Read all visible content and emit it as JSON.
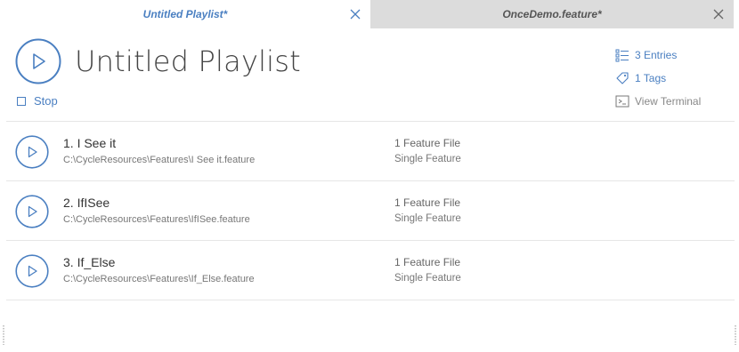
{
  "tabs": [
    {
      "label": "Untitled Playlist*",
      "active": true,
      "icon": "close-icon"
    },
    {
      "label": "OnceDemo.feature*",
      "active": false,
      "icon": "close-icon"
    }
  ],
  "header": {
    "title": "Untitled Playlist",
    "play_icon": "play-circle-icon",
    "stop_label": "Stop",
    "stop_icon": "stop-square-icon"
  },
  "meta": {
    "entries_label": "3 Entries",
    "entries_icon": "list-icon",
    "tags_label": "1 Tags",
    "tags_icon": "tag-icon",
    "terminal_label": "View Terminal",
    "terminal_icon": "terminal-icon"
  },
  "entries": [
    {
      "name": "1. I See it",
      "path": "C:\\CycleResources\\Features\\I See it.feature",
      "count": "1 Feature File",
      "kind": "Single Feature"
    },
    {
      "name": "2. IfISee",
      "path": "C:\\CycleResources\\Features\\IfISee.feature",
      "count": "1 Feature File",
      "kind": "Single Feature"
    },
    {
      "name": "3. If_Else",
      "path": "C:\\CycleResources\\Features\\If_Else.feature",
      "count": "1 Feature File",
      "kind": "Single Feature"
    }
  ],
  "colors": {
    "accent": "#4a7fc1",
    "inactive_tab": "#dcdcdc",
    "divider": "#e6e6e6"
  }
}
